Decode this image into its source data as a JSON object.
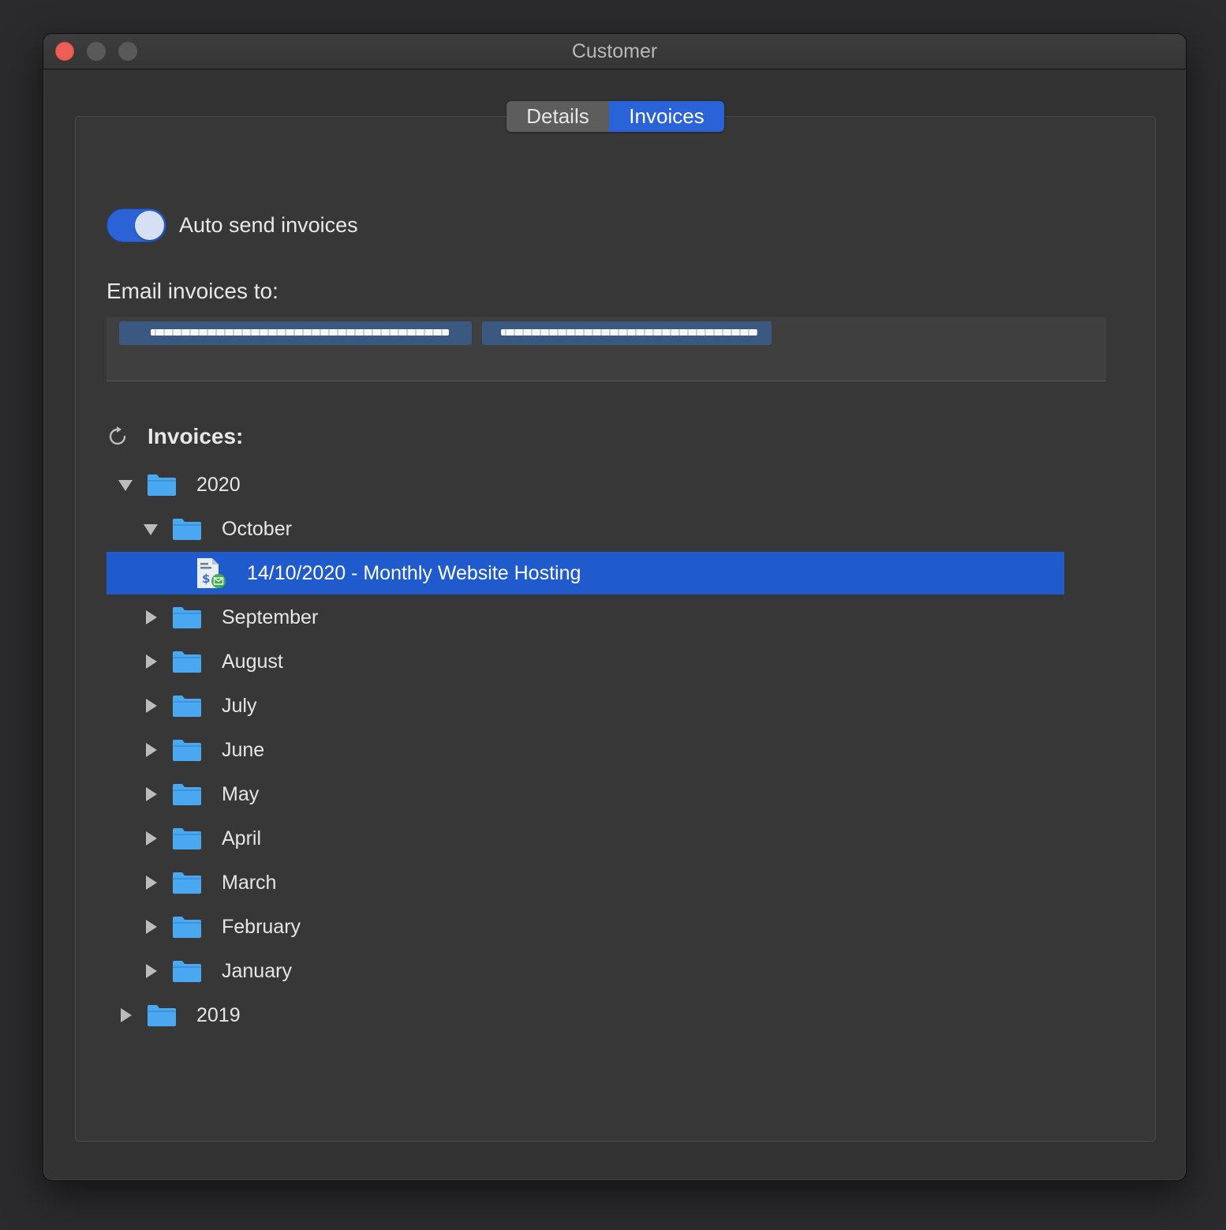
{
  "window": {
    "title": "Customer"
  },
  "tabs": [
    {
      "label": "Details",
      "selected": false
    },
    {
      "label": "Invoices",
      "selected": true
    }
  ],
  "auto_send": {
    "label": "Auto send invoices",
    "enabled": true
  },
  "email": {
    "label": "Email invoices to:",
    "recipients": [
      "[redacted]",
      "[redacted]"
    ]
  },
  "invoices": {
    "title": "Invoices:",
    "tree": {
      "year_2020": "2020",
      "october": "October",
      "invoice_item": "14/10/2020 - Monthly Website Hosting",
      "september": "September",
      "august": "August",
      "july": "July",
      "june": "June",
      "may": "May",
      "april": "April",
      "march": "March",
      "february": "February",
      "january": "January",
      "year_2019": "2019"
    }
  },
  "colors": {
    "accent": "#2a62d8",
    "selection": "#1f5bcc",
    "folder": "#4aa8f0",
    "close": "#ec5f57"
  }
}
